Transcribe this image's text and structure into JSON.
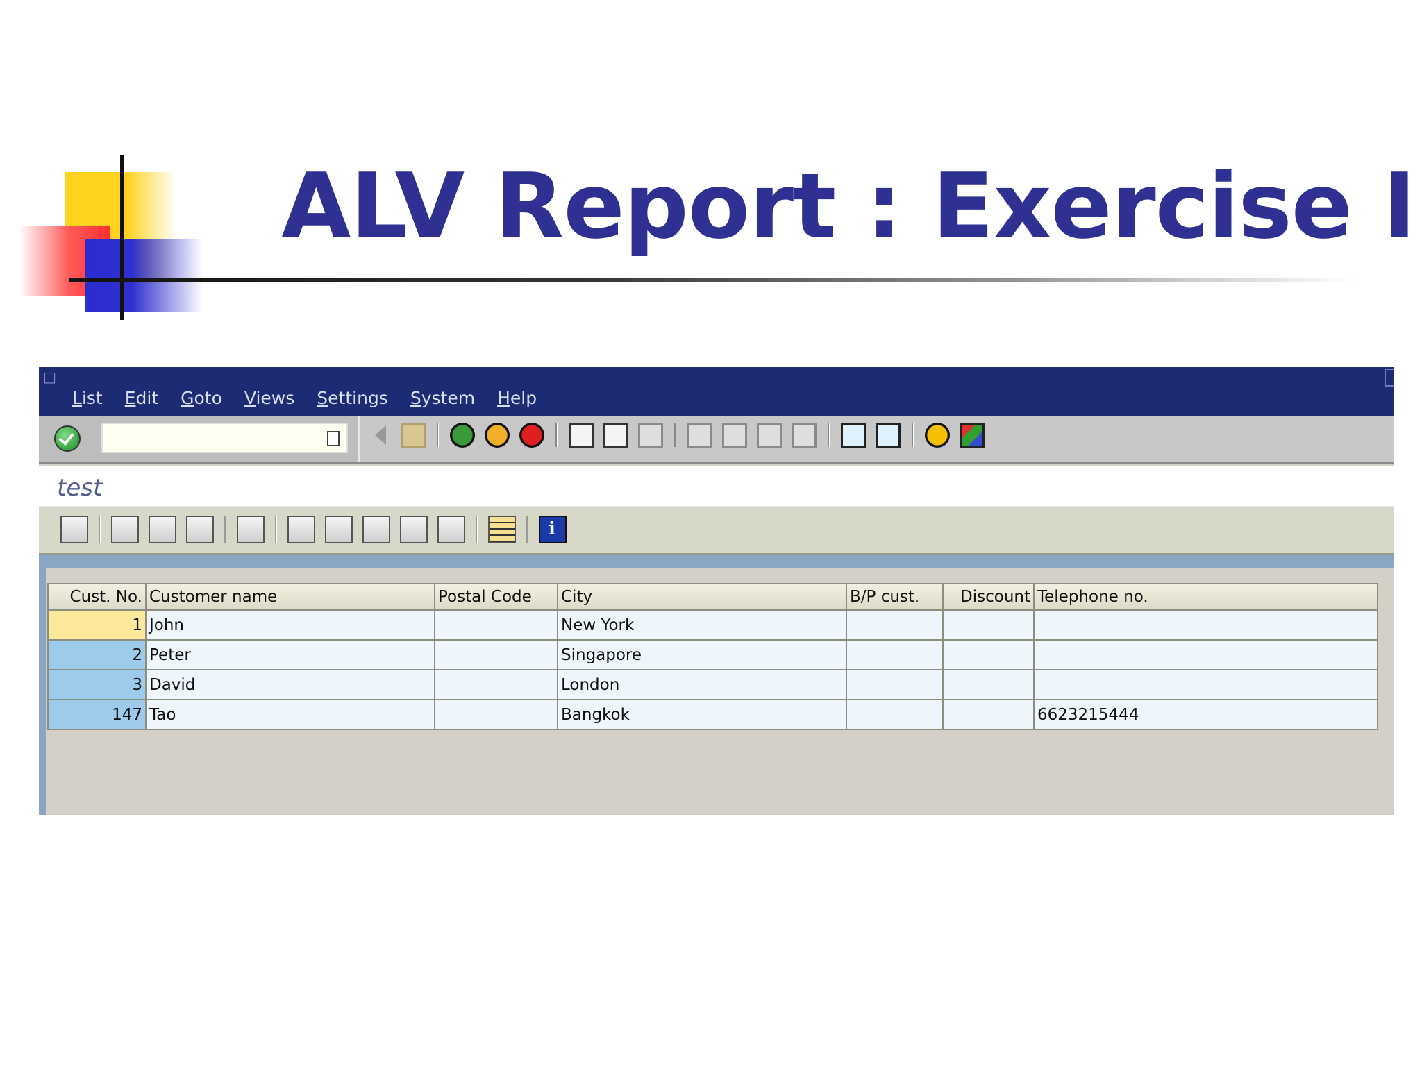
{
  "slide": {
    "title": "ALV Report : Exercise I"
  },
  "window": {
    "menu": [
      {
        "accel": "L",
        "rest": "ist"
      },
      {
        "accel": "E",
        "rest": "dit"
      },
      {
        "accel": "G",
        "rest": "oto"
      },
      {
        "accel": "V",
        "rest": "iews"
      },
      {
        "accel": "S",
        "rest": "ettings"
      },
      {
        "accel": "",
        "mid": "S",
        "rest": "ystem",
        "full": "System"
      },
      {
        "accel": "H",
        "rest": "elp"
      }
    ],
    "command_field": {
      "value": ""
    },
    "program_title": "test"
  },
  "table": {
    "columns": [
      "Cust. No.",
      "Customer name",
      "Postal Code",
      "City",
      "B/P cust.",
      "Discount",
      "Telephone no."
    ],
    "rows": [
      {
        "cust_no": "1",
        "name": "John",
        "postal": "",
        "city": "New York",
        "bp": "",
        "discount": "",
        "phone": ""
      },
      {
        "cust_no": "2",
        "name": "Peter",
        "postal": "",
        "city": "Singapore",
        "bp": "",
        "discount": "",
        "phone": ""
      },
      {
        "cust_no": "3",
        "name": "David",
        "postal": "",
        "city": "London",
        "bp": "",
        "discount": "",
        "phone": ""
      },
      {
        "cust_no": "147",
        "name": "Tao",
        "postal": "",
        "city": "Bangkok",
        "bp": "",
        "discount": "",
        "phone": "6623215444"
      }
    ]
  },
  "colors": {
    "title": "#2e3192",
    "menubar": "#1c2b74",
    "key_cell": "#9ccbec",
    "selected_key_cell": "#fde99a"
  }
}
